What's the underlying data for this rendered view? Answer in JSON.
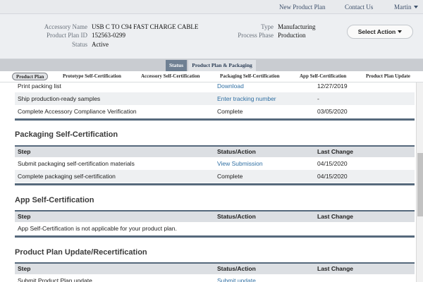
{
  "topnav": {
    "new_plan": "New Product Plan",
    "contact": "Contact Us",
    "user": "Martin"
  },
  "header": {
    "accessory_name_label": "Accessory Name",
    "accessory_name": "USB C TO C94 FAST CHARGE CABLE",
    "plan_id_label": "Product Plan ID",
    "plan_id": "152563-0299",
    "status_label": "Status",
    "status": "Active",
    "type_label": "Type",
    "type": "Manufacturing",
    "phase_label": "Process Phase",
    "phase": "Production",
    "select_action": "Select Action"
  },
  "tabs": [
    {
      "label": "Status",
      "active": true
    },
    {
      "label": "Product Plan & Packaging",
      "active": false
    }
  ],
  "steps": [
    {
      "label": "Product Plan",
      "active": true
    },
    {
      "label": "Prototype Self-Certification",
      "active": false
    },
    {
      "label": "Accessory Self-Certification",
      "active": false
    },
    {
      "label": "Packaging Self-Certification",
      "active": false
    },
    {
      "label": "App Self-Certification",
      "active": false
    },
    {
      "label": "Product Plan Update",
      "active": false
    }
  ],
  "top_rows": [
    {
      "step": "Print packing list",
      "status": "Download",
      "change": "12/27/2019"
    },
    {
      "step": "Ship production-ready samples",
      "status": "Enter tracking number",
      "change": "-"
    },
    {
      "step": "Complete Accessory Compliance Verification",
      "status": "Complete",
      "change": "03/05/2020"
    }
  ],
  "columns": {
    "step": "Step",
    "status": "Status/Action",
    "change": "Last Change"
  },
  "packaging": {
    "title": "Packaging Self-Certification",
    "rows": [
      {
        "step": "Submit packaging self-certification materials",
        "status": "View Submission",
        "change": "04/15/2020"
      },
      {
        "step": "Complete packaging self-certification",
        "status": "Complete",
        "change": "04/15/2020"
      }
    ]
  },
  "app": {
    "title": "App Self-Certification",
    "message": "App Self-Certification is not applicable for your product plan."
  },
  "update": {
    "title": "Product Plan Update/Recertification",
    "rows": [
      {
        "step": "Submit Product Plan update",
        "status": "Submit update",
        "change": ""
      }
    ]
  }
}
